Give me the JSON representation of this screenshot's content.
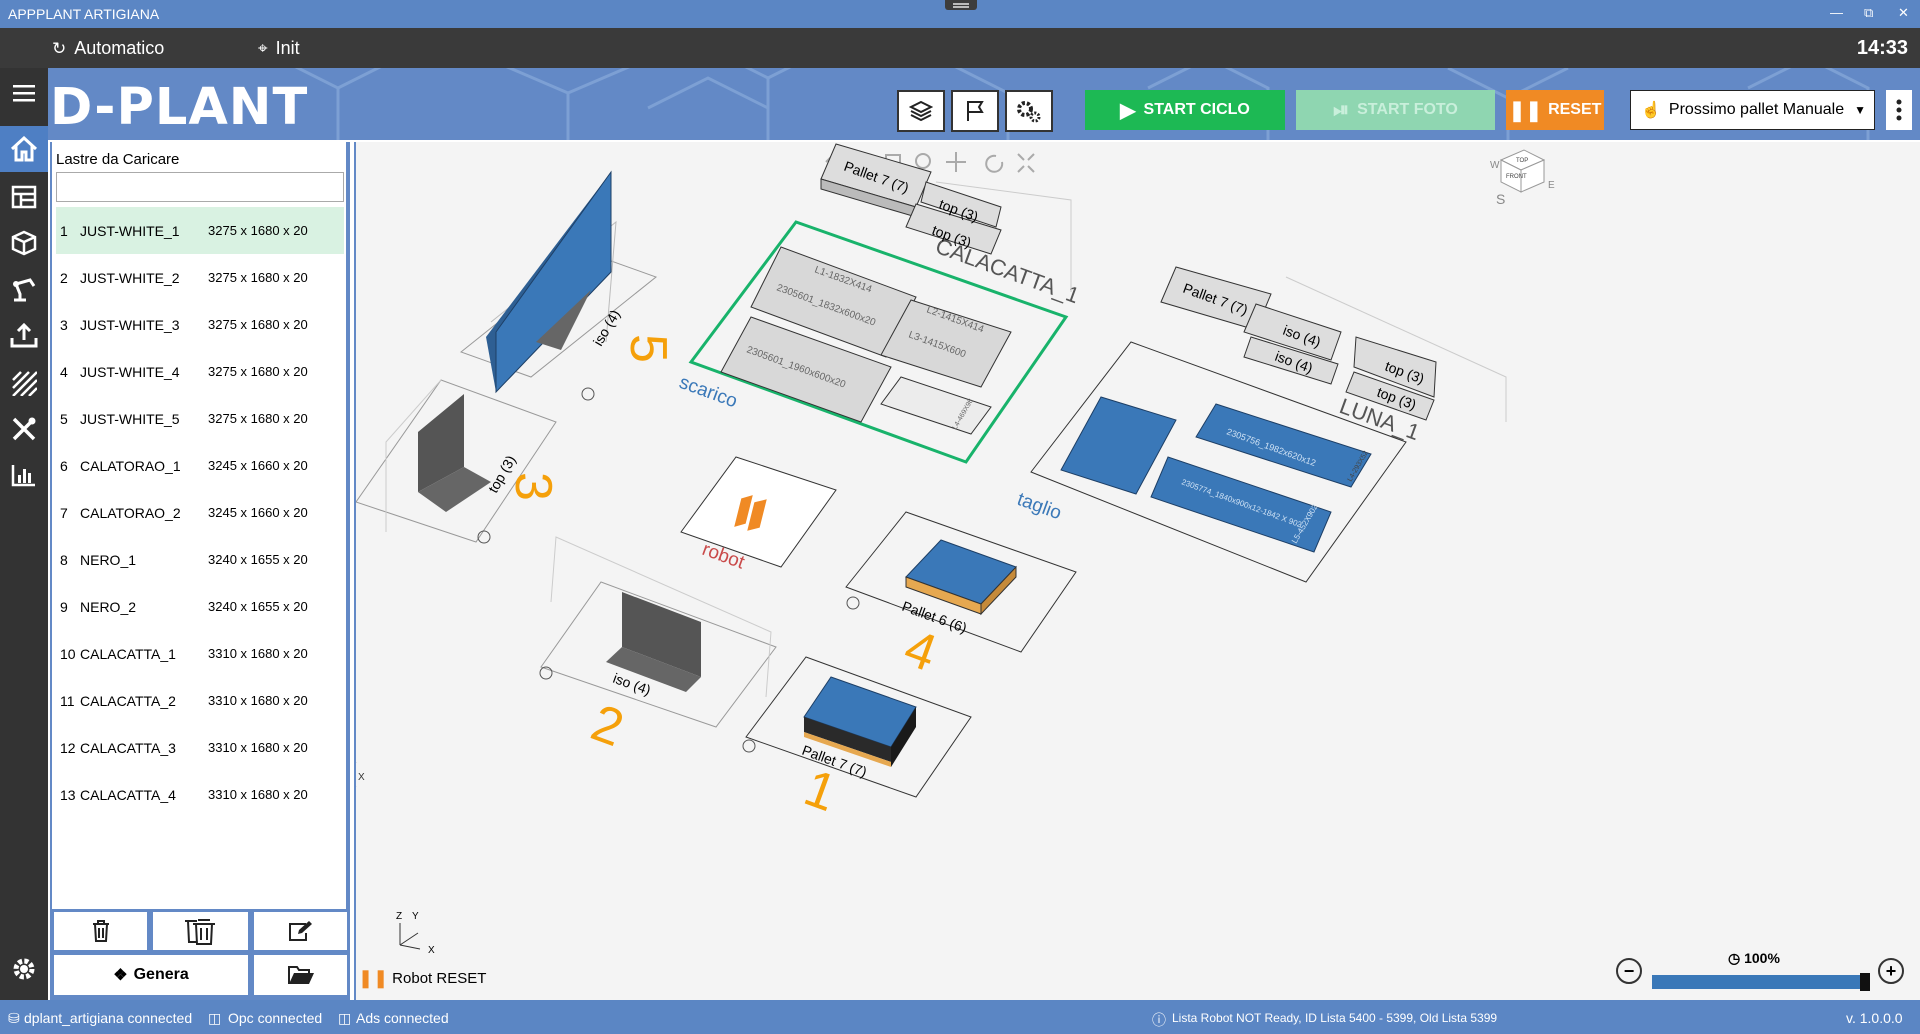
{
  "window": {
    "title": "APPPLANT ARTIGIANA"
  },
  "modes": {
    "automatic": "Automatico",
    "init": "Init"
  },
  "clock": "14:33",
  "logo": "D-PLANT",
  "toolbar": {
    "start_cycle": "START CICLO",
    "start_photo": "START FOTO",
    "reset": "RESET",
    "pallet_select": "Prossimo pallet Manuale"
  },
  "panel": {
    "title": "Lastre da Caricare",
    "search_value": "",
    "slabs": [
      {
        "n": "1",
        "name": "JUST-WHITE_1",
        "dims": "3275 x 1680 x 20"
      },
      {
        "n": "2",
        "name": "JUST-WHITE_2",
        "dims": "3275 x 1680 x 20"
      },
      {
        "n": "3",
        "name": "JUST-WHITE_3",
        "dims": "3275 x 1680 x 20"
      },
      {
        "n": "4",
        "name": "JUST-WHITE_4",
        "dims": "3275 x 1680 x 20"
      },
      {
        "n": "5",
        "name": "JUST-WHITE_5",
        "dims": "3275 x 1680 x 20"
      },
      {
        "n": "6",
        "name": "CALATORAO_1",
        "dims": "3245 x 1660 x 20"
      },
      {
        "n": "7",
        "name": "CALATORAO_2",
        "dims": "3245 x 1660 x 20"
      },
      {
        "n": "8",
        "name": "NERO_1",
        "dims": "3240 x 1655 x 20"
      },
      {
        "n": "9",
        "name": "NERO_2",
        "dims": "3240 x 1655 x 20"
      },
      {
        "n": "10",
        "name": "CALACATTA_1",
        "dims": "3310 x 1680 x 20"
      },
      {
        "n": "11",
        "name": "CALACATTA_2",
        "dims": "3310 x 1680 x 20"
      },
      {
        "n": "12",
        "name": "CALACATTA_3",
        "dims": "3310 x 1680 x 20"
      },
      {
        "n": "13",
        "name": "CALACATTA_4",
        "dims": "3310 x 1680 x 20"
      }
    ],
    "generate": "Genera"
  },
  "scene": {
    "zones": {
      "scarico": "scarico",
      "taglio": "taglio",
      "robot": "robot"
    },
    "numbers": {
      "n1": "1",
      "n2": "2",
      "n3": "3",
      "n4": "4",
      "n5": "5"
    },
    "labels": {
      "pallet7_top": "Pallet 7 (7)",
      "top3_a": "top (3)",
      "top3_b": "top (3)",
      "calacatta": "CALACATTA_1",
      "pallet7_right": "Pallet 7 (7)",
      "iso4_a": "iso (4)",
      "iso4_b": "iso (4)",
      "top3_c": "top (3)",
      "top3_d": "top (3)",
      "luna": "LUNA_1",
      "iso4_st5": "iso (4)",
      "top3_st3": "top (3)",
      "iso4_st2": "iso (4)",
      "pallet6": "Pallet 6 (6)",
      "pallet7_st1": "Pallet 7 (7)",
      "piece_l1": "L1-1832X414",
      "piece_a": "2305601_1832x600x20",
      "piece_l2": "L2-1415X414",
      "piece_l3": "L3-1415X600",
      "piece_b": "2305601_1960x600x20",
      "piece_small": "L4-469X98",
      "cut_a": "2305756_1982x620x12",
      "cut_b": "2305774_1840x900x12-1842 X 902",
      "cut_c": "L5-452X902",
      "cut_d": "L4-293X52"
    },
    "robot_status": "Robot RESET",
    "zoom": "100%",
    "zoom_fraction": 0.98,
    "axes": {
      "x": "X",
      "y": "Y",
      "z": "Z"
    },
    "nav_cube": {
      "top": "TOP",
      "front": "FRONT",
      "s": "S",
      "e": "E",
      "w": "W"
    }
  },
  "status": {
    "db": "dplant_artigiana connected",
    "opc": "Opc connected",
    "ads": "Ads connected",
    "info": "Lista Robot NOT Ready, ID Lista 5400 - 5399, Old Lista 5399",
    "version": "v. 1.0.0.0"
  },
  "colors": {
    "accent": "#6389c6",
    "start": "#1db954",
    "reset": "#f08a24",
    "slab_blue": "#3a78b8",
    "orange_label": "#f5a00a"
  }
}
